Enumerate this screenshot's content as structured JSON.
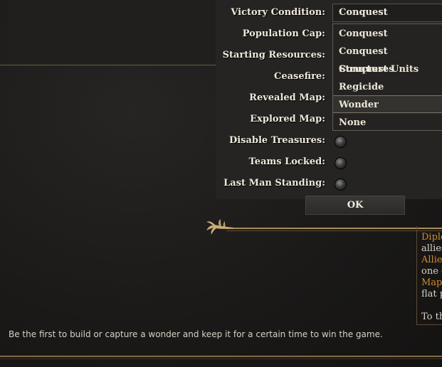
{
  "settings": {
    "labels": {
      "victory": "Victory Condition:",
      "population": "Population Cap:",
      "resources": "Starting Resources:",
      "ceasefire": "Ceasefire:",
      "revealed": "Revealed Map:",
      "explored": "Explored Map:",
      "treasures": "Disable Treasures:",
      "teams": "Teams Locked:",
      "lastman": "Last Man Standing:"
    },
    "victory_value": "Conquest",
    "dropdown_options": [
      "Conquest",
      "Conquest Structures",
      "Conquest Units",
      "Regicide",
      "Wonder",
      "None"
    ],
    "highlighted_option": "Wonder",
    "ok_label": "OK"
  },
  "right_panel": {
    "lines": [
      "Diplo",
      "allies",
      "Allied",
      "one g",
      "Map",
      "flat p",
      "To th"
    ]
  },
  "description": "Be the first to build or capture a wonder and keep it for a certain time to win the game."
}
